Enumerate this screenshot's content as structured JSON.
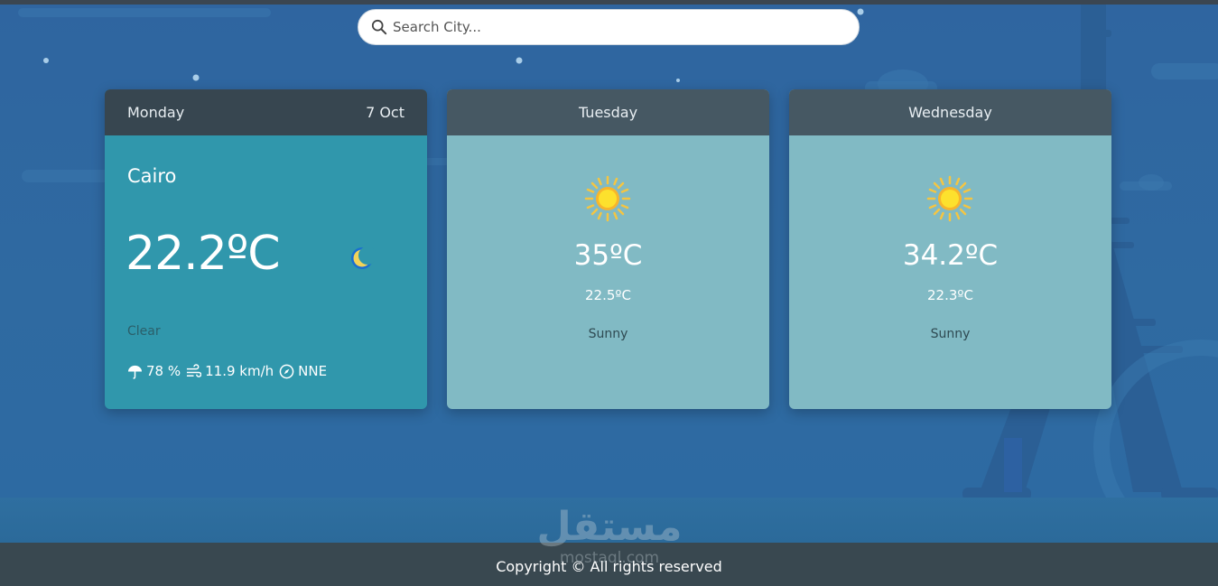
{
  "search": {
    "placeholder": "Search City..."
  },
  "today": {
    "day": "Monday",
    "date": "7 Oct",
    "city": "Cairo",
    "temp": "22.2ºC",
    "condition": "Clear",
    "icon": "moon-icon",
    "humidity": "78 %",
    "wind_speed": "11.9 km/h",
    "wind_dir": "NNE"
  },
  "forecast": [
    {
      "day": "Tuesday",
      "icon": "sun-icon",
      "max": "35ºC",
      "min": "22.5ºC",
      "condition": "Sunny"
    },
    {
      "day": "Wednesday",
      "icon": "sun-icon",
      "max": "34.2ºC",
      "min": "22.3ºC",
      "condition": "Sunny"
    }
  ],
  "footer": {
    "copyright": "Copyright © All rights reserved"
  },
  "watermark": {
    "arabic": "مستقل",
    "latin": "mostaql.com"
  },
  "colors": {
    "background": "#2e6aa0",
    "today_card": "#3097ac",
    "forecast_card": "#81bac4",
    "today_header": "#374650",
    "forecast_header": "#465863",
    "footer": "#394850"
  }
}
